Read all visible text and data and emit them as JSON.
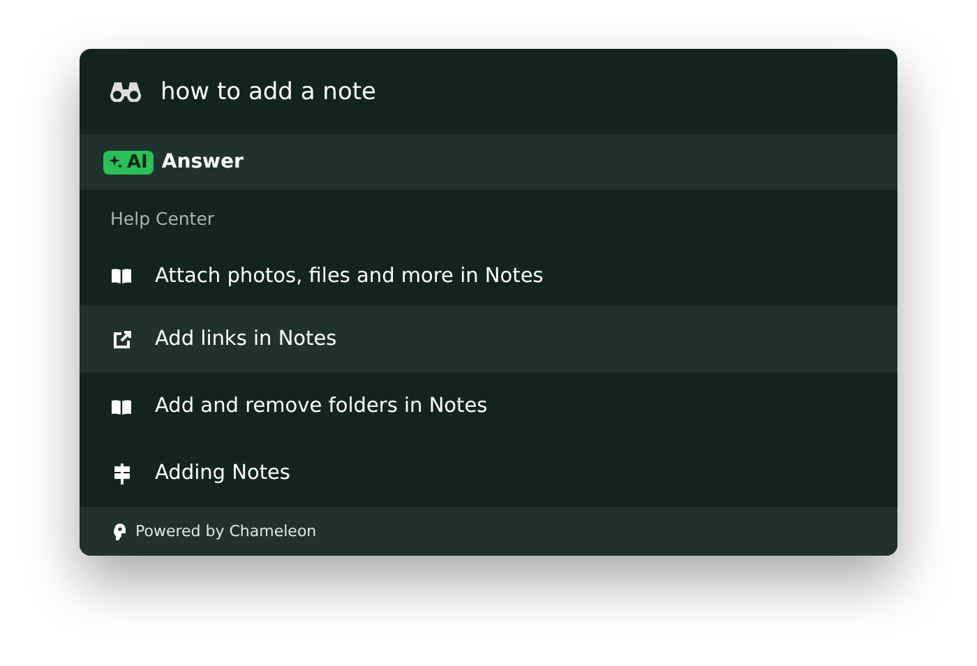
{
  "search": {
    "value": "how to add a note"
  },
  "ai_answer": {
    "badge": "AI",
    "label": "Answer"
  },
  "section": {
    "title": "Help Center"
  },
  "results": [
    {
      "kind": "book",
      "label": "Attach photos, files and more in Notes",
      "selected": false
    },
    {
      "kind": "link",
      "label": "Add links in Notes",
      "selected": true
    },
    {
      "kind": "book",
      "label": "Add and remove folders in Notes",
      "selected": false
    },
    {
      "kind": "signpost",
      "label": "Adding Notes",
      "selected": false
    }
  ],
  "footer": {
    "text": "Powered by Chameleon"
  }
}
